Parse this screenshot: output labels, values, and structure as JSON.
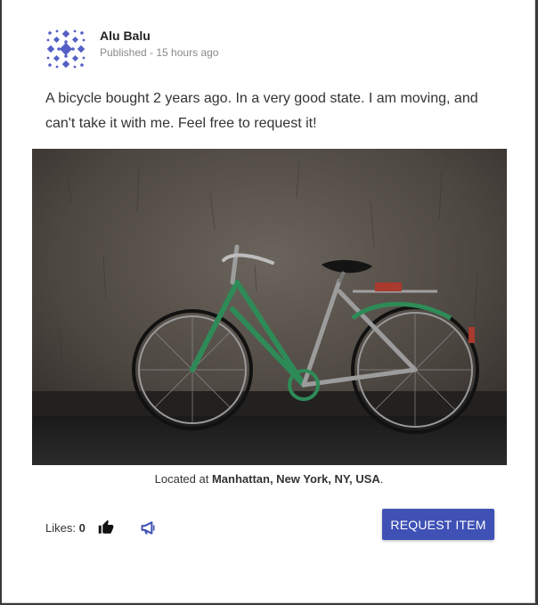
{
  "post": {
    "author": "Alu Balu",
    "published": "Published - 15 hours ago",
    "description": "A bicycle bought 2 years ago. In a very good state. I am moving, and can't take it with me. Feel free to request it!"
  },
  "location": {
    "prefix": "Located at ",
    "place": "Manhattan, New York, NY, USA",
    "suffix": "."
  },
  "likes": {
    "label": "Likes: ",
    "count": "0"
  },
  "actions": {
    "request_label": "REQUEST ITEM"
  },
  "icons": {
    "like": "thumbs-up-icon",
    "share": "megaphone-icon"
  },
  "colors": {
    "accent": "#3f51b5",
    "bicycle_frame": "#2e8b57"
  }
}
